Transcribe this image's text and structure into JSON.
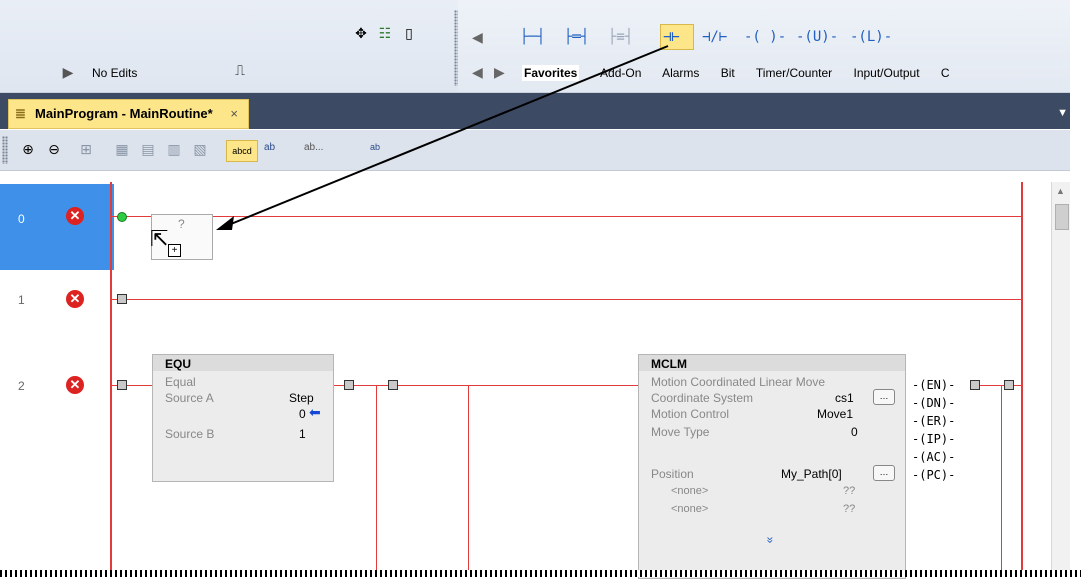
{
  "status": {
    "mode": "No Edits"
  },
  "toolbar": {
    "instructions": [
      "⊣⊢",
      "⊣/⊢",
      "-( )-",
      "-(U)-",
      "-(L)-"
    ],
    "tabs": [
      "Favorites",
      "Add-On",
      "Alarms",
      "Bit",
      "Timer/Counter",
      "Input/Output",
      "C"
    ]
  },
  "editor": {
    "tab_title": "MainProgram - MainRoutine*",
    "close_glyph": "×",
    "tool_labels": [
      "abcd",
      "ab",
      "ab...",
      "ab"
    ]
  },
  "rungs": [
    {
      "number": "0"
    },
    {
      "number": "1"
    },
    {
      "number": "2"
    }
  ],
  "placeholder": {
    "text": "?"
  },
  "equ": {
    "name": "EQU",
    "desc": "Equal",
    "source_a_label": "Source A",
    "source_a_value": "Step",
    "source_a_sub": "0",
    "source_b_label": "Source B",
    "source_b_value": "1"
  },
  "mclm": {
    "name": "MCLM",
    "desc": "Motion Coordinated Linear Move",
    "rows": [
      {
        "label": "Coordinate System",
        "value": "cs1"
      },
      {
        "label": "Motion Control",
        "value": "Move1"
      },
      {
        "label": "Move Type",
        "value": "0"
      }
    ],
    "position_label": "Position",
    "position_value": "My_Path[0]",
    "none1": "<none>",
    "none2": "<none>",
    "q1": "??",
    "q2": "??",
    "more": "»",
    "outputs": [
      "EN",
      "DN",
      "ER",
      "IP",
      "AC",
      "PC"
    ]
  }
}
